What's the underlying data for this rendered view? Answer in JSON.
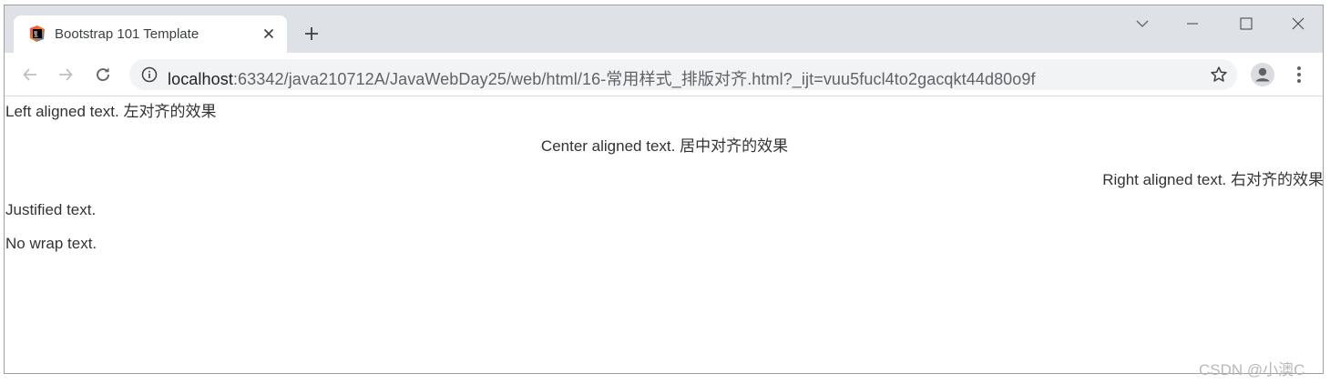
{
  "browser": {
    "tab": {
      "title": "Bootstrap 101 Template",
      "favicon": "jetbrains-icon"
    },
    "new_tab_icon": "plus-icon",
    "window_controls": [
      "chevron-down-icon",
      "minimize-icon",
      "maximize-icon",
      "close-icon"
    ],
    "address_bar": {
      "host": "localhost",
      "rest": ":63342/java210712A/JavaWebDay25/web/html/16-常用样式_排版对齐.html?_ijt=vuu5fucl4to2gacqkt44d80o9f"
    }
  },
  "page": {
    "left_text": "Left aligned text. 左对齐的效果",
    "center_text": "Center aligned text. 居中对齐的效果",
    "right_text": "Right aligned text. 右对齐的效果",
    "justify_text": "Justified text.",
    "nowrap_text": "No wrap text."
  },
  "watermark": "CSDN @小澳C",
  "colors": {
    "tabstrip": "#dee1e6",
    "omnibox": "#f1f3f4",
    "page_text": "#333333"
  }
}
